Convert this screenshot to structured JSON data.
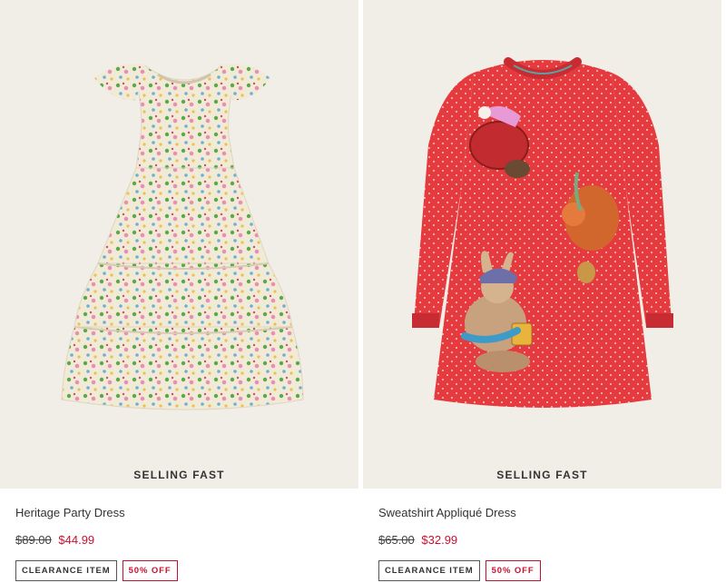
{
  "products": [
    {
      "name": "Heritage Party Dress",
      "badge": "SELLING FAST",
      "old_price": "$89.00",
      "sale_price": "$44.99",
      "tags": [
        "CLEARANCE ITEM",
        "50% OFF"
      ],
      "image_bg": "#f1ede7",
      "garment_color": "#f1ead6"
    },
    {
      "name": "Sweatshirt Appliqué Dress",
      "badge": "SELLING FAST",
      "old_price": "$65.00",
      "sale_price": "$32.99",
      "tags": [
        "CLEARANCE ITEM",
        "50% OFF"
      ],
      "image_bg": "#f1ede7",
      "garment_color": "#e63b3e"
    }
  ],
  "colors": {
    "sale": "#c8102e",
    "text": "#333333"
  }
}
